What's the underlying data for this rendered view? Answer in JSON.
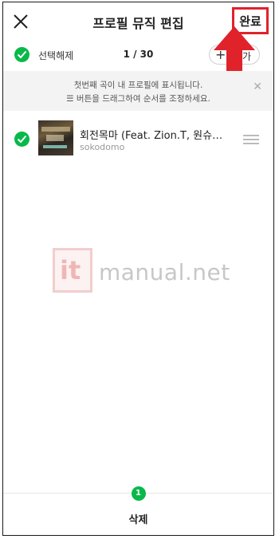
{
  "header": {
    "title": "프로필 뮤직 편집",
    "done_label": "완료"
  },
  "selection": {
    "deselect_label": "선택해제",
    "count": "1 / 30",
    "add_label": "가"
  },
  "notice": {
    "line1": "첫번째 곡이 내 프로필에 표시됩니다.",
    "line2": "☰ 버튼을 드래그하여 순서를 조정하세요."
  },
  "songs": [
    {
      "title": "회전목마 (Feat. Zion.T, 원슈…",
      "artist": "sokodomo"
    }
  ],
  "watermark": {
    "logo": "it",
    "text": "manual.net"
  },
  "footer": {
    "badge_count": "1",
    "delete_label": "삭제"
  },
  "colors": {
    "accent_green": "#08b94a",
    "highlight_red": "#e0232b"
  }
}
